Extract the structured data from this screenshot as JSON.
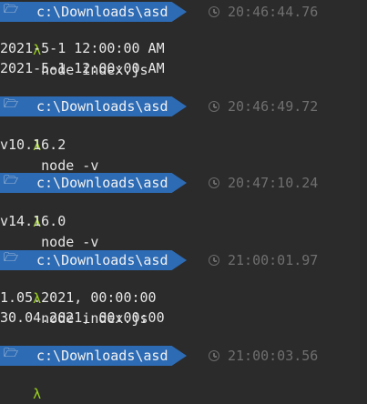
{
  "blocks": [
    {
      "path": "c:\\Downloads\\asd",
      "time": "20:46:44.76",
      "prompt_symbol": "λ",
      "command": "node index.js",
      "output": [
        "2021-5-1 12:00:00 AM",
        "2021-5-1 12:00:00 AM"
      ]
    },
    {
      "path": "c:\\Downloads\\asd",
      "time": "20:46:49.72",
      "prompt_symbol": "λ",
      "command": "node -v",
      "output": [
        "v10.16.2"
      ]
    },
    {
      "path": "c:\\Downloads\\asd",
      "time": "20:47:10.24",
      "prompt_symbol": "λ",
      "command": "node -v",
      "output": [
        "v14.16.0"
      ]
    },
    {
      "path": "c:\\Downloads\\asd",
      "time": "21:00:01.97",
      "prompt_symbol": "λ",
      "command": "node index.js",
      "output": [
        "1.05.2021, 00:00:00",
        "30.04.2021, 00:00:00"
      ]
    },
    {
      "path": "c:\\Downloads\\asd",
      "time": "21:00:03.56",
      "prompt_symbol": "λ",
      "command": "",
      "output": []
    }
  ],
  "icons": {
    "folder": "folder-icon",
    "clock": "clock-icon"
  },
  "colors": {
    "background": "#2b2b2b",
    "segment": "#2d6bb4",
    "lambda": "#9bd11e",
    "timestamp": "#6f6f6f"
  }
}
